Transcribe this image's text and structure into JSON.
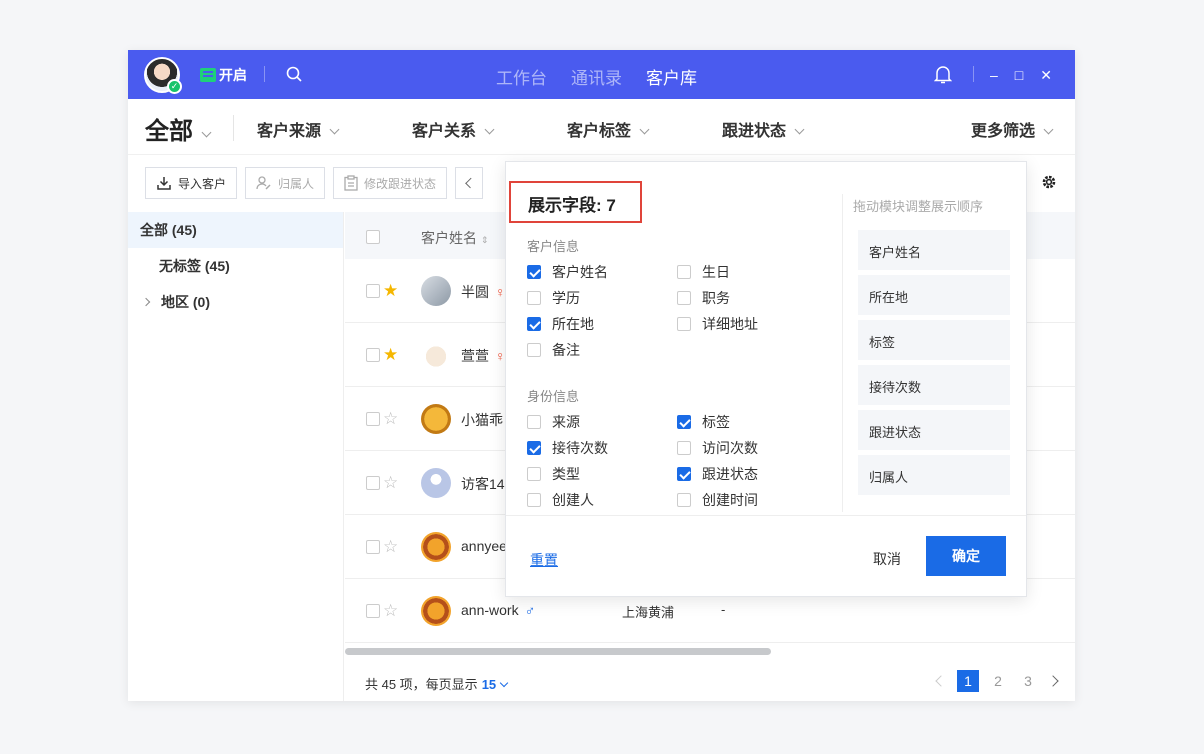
{
  "topbar": {
    "open_label": "开启",
    "tabs": [
      "工作台",
      "通讯录",
      "客户库"
    ],
    "active_tab": "客户库",
    "win_minimize": "–",
    "win_maximize": "□",
    "win_close": "✕"
  },
  "filters": {
    "all": "全部",
    "items": [
      "客户来源",
      "客户关系",
      "客户标签",
      "跟进状态",
      "更多筛选"
    ]
  },
  "toolbar": {
    "import": "导入客户",
    "owner": "归属人",
    "follow_status": "修改跟进状态"
  },
  "sidebar": {
    "all": "全部",
    "all_count": "(45)",
    "untagged": "无标签",
    "untagged_count": "(45)",
    "region": "地区",
    "region_count": "(0)"
  },
  "table": {
    "col_name": "客户姓名",
    "rows": [
      {
        "name": "半圆",
        "sex": "♀",
        "starred": true,
        "location": "",
        "dash": ""
      },
      {
        "name": "萱萱",
        "sex": "♀",
        "starred": true,
        "location": "",
        "dash": ""
      },
      {
        "name": "小猫乖",
        "sex": "",
        "starred": false,
        "location": "",
        "dash": ""
      },
      {
        "name": "访客14",
        "sex": "",
        "starred": false,
        "location": "",
        "dash": ""
      },
      {
        "name": "annyee",
        "sex": "",
        "starred": false,
        "location": "",
        "dash": ""
      },
      {
        "name": "ann-work",
        "sex": "♂",
        "starred": false,
        "location": "上海黄浦",
        "dash": "-"
      }
    ]
  },
  "footer": {
    "total_text": "共 45 项，每页显示",
    "page_size": "15",
    "pages": [
      "1",
      "2",
      "3"
    ],
    "current_page": "1"
  },
  "popup": {
    "title": "展示字段: 7",
    "sec_customer": "客户信息",
    "sec_identity": "身份信息",
    "customer_opts": [
      {
        "label": "客户姓名",
        "checked": true
      },
      {
        "label": "生日",
        "checked": false
      },
      {
        "label": "学历",
        "checked": false
      },
      {
        "label": "职务",
        "checked": false
      },
      {
        "label": "所在地",
        "checked": true
      },
      {
        "label": "详细地址",
        "checked": false
      },
      {
        "label": "备注",
        "checked": false
      }
    ],
    "identity_opts": [
      {
        "label": "来源",
        "checked": false
      },
      {
        "label": "标签",
        "checked": true
      },
      {
        "label": "接待次数",
        "checked": true
      },
      {
        "label": "访问次数",
        "checked": false
      },
      {
        "label": "类型",
        "checked": false
      },
      {
        "label": "跟进状态",
        "checked": true
      },
      {
        "label": "创建人",
        "checked": false
      },
      {
        "label": "创建时间",
        "checked": false
      }
    ],
    "order_hint": "拖动模块调整展示顺序",
    "order_blocks": [
      "客户姓名",
      "所在地",
      "标签",
      "接待次数",
      "跟进状态",
      "归属人"
    ],
    "reset": "重置",
    "cancel": "取消",
    "confirm": "确定"
  },
  "colors": {
    "topbar": "#4a5bef",
    "accent": "#1a6be6",
    "highlight_border": "#e0443a"
  }
}
